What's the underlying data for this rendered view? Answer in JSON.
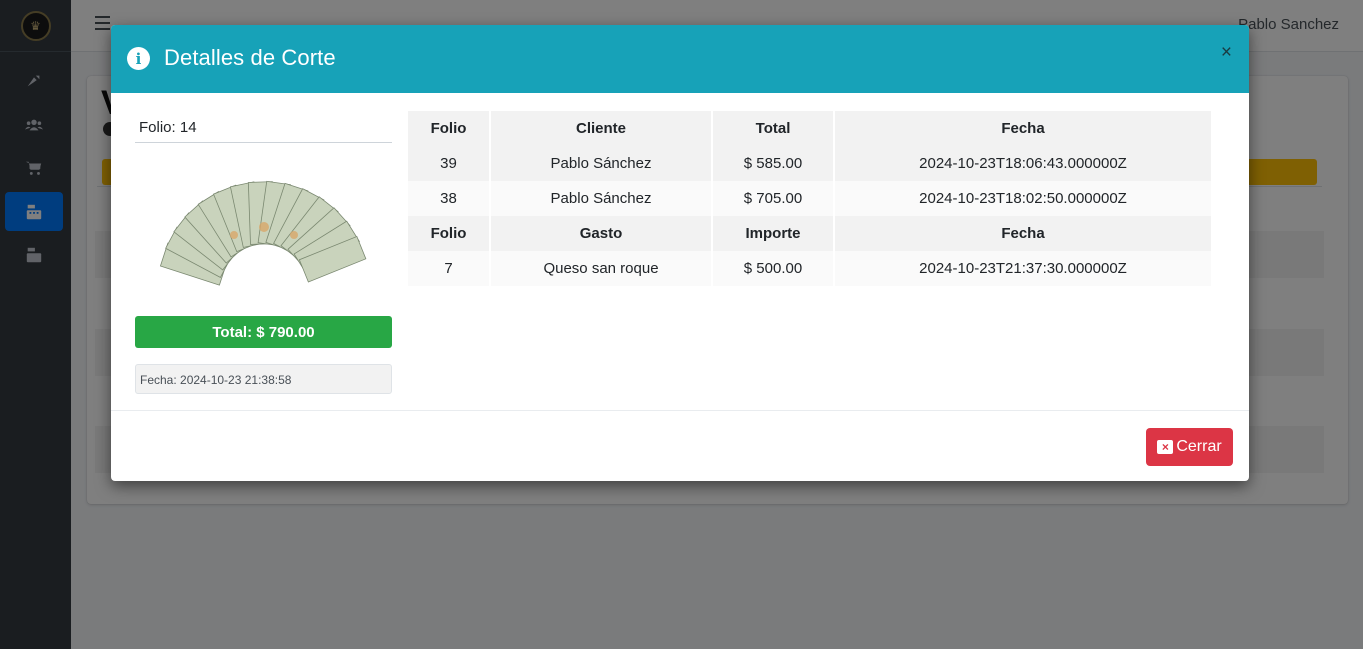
{
  "topbar": {
    "user_name": "Pablo Sanchez"
  },
  "background": {
    "title_char": "V"
  },
  "modal": {
    "title": "Detalles de Corte",
    "close_symbol": "×",
    "folio": "Folio: 14",
    "total": "Total: $ 790.00",
    "fecha": "Fecha: 2024-10-23 21:38:58",
    "cerrar_label": "Cerrar",
    "ventas_headers": [
      "Folio",
      "Cliente",
      "Total",
      "Fecha"
    ],
    "ventas_rows": [
      [
        "39",
        "Pablo Sánchez",
        "$ 585.00",
        "2024-10-23T18:06:43.000000Z"
      ],
      [
        "38",
        "Pablo Sánchez",
        "$ 705.00",
        "2024-10-23T18:02:50.000000Z"
      ]
    ],
    "gastos_headers": [
      "Folio",
      "Gasto",
      "Importe",
      "Fecha"
    ],
    "gastos_rows": [
      [
        "7",
        "Queso san roque",
        "$ 500.00",
        "2024-10-23T21:37:30.000000Z"
      ]
    ]
  },
  "colors": {
    "header": "#17a2b8",
    "success": "#28a745",
    "danger": "#dc3545",
    "sidebar": "#343a40",
    "active": "#007bff"
  },
  "icons": [
    "logo-icon",
    "gauge-icon",
    "users-icon",
    "cart-icon",
    "cash-register-icon",
    "cash-register-icon",
    "info-icon",
    "close-icon",
    "money-image",
    "window-close-icon"
  ]
}
